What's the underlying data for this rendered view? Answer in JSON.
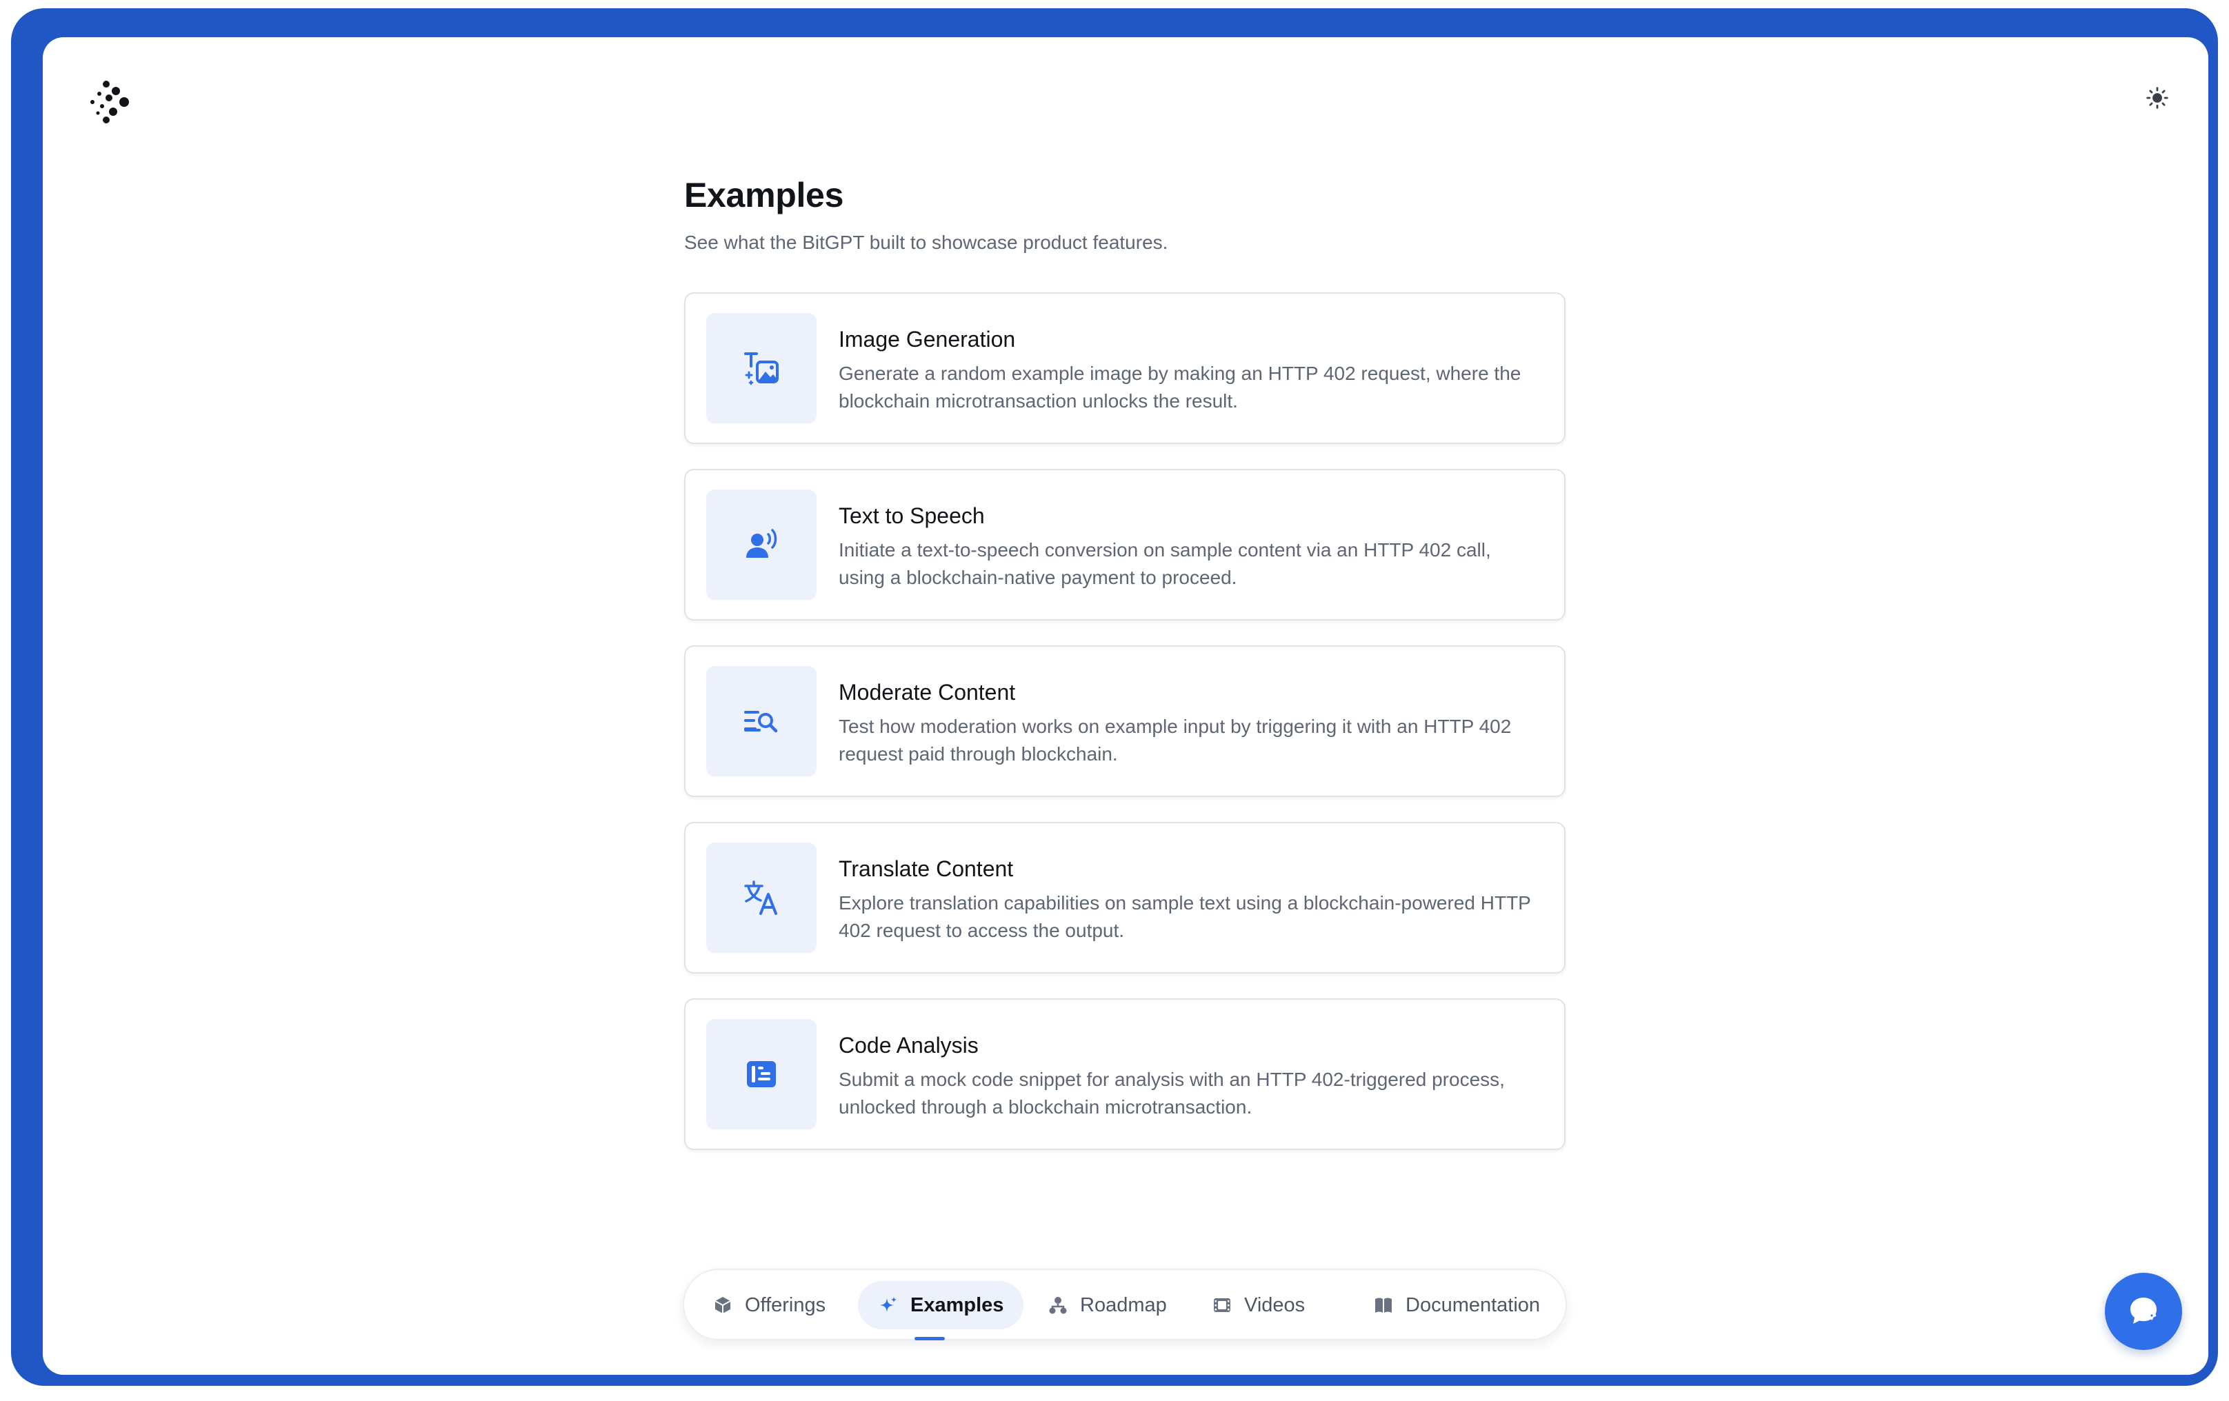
{
  "page": {
    "title": "Examples",
    "subtitle": "See what the BitGPT built to showcase product features."
  },
  "examples": [
    {
      "title": "Image Generation",
      "description": "Generate a random example image by making an HTTP 402 request, where the blockchain microtransaction unlocks the result.",
      "icon": "text-to-image-icon"
    },
    {
      "title": "Text to Speech",
      "description": "Initiate a text-to-speech conversion on sample content via an HTTP 402 call, using a blockchain-native payment to proceed.",
      "icon": "voice-icon"
    },
    {
      "title": "Moderate Content",
      "description": "Test how moderation works on example input by triggering it with an HTTP 402 request paid through blockchain.",
      "icon": "text-search-icon"
    },
    {
      "title": "Translate Content",
      "description": "Explore translation capabilities on sample text using a blockchain-powered HTTP 402 request to access the output.",
      "icon": "translate-icon"
    },
    {
      "title": "Code Analysis",
      "description": "Submit a mock code snippet for analysis with an HTTP 402-triggered process, unlocked through a blockchain microtransaction.",
      "icon": "code-list-icon"
    }
  ],
  "nav": {
    "items": [
      {
        "label": "Offerings",
        "icon": "cube-icon",
        "active": false
      },
      {
        "label": "Examples",
        "icon": "sparkle-icon",
        "active": true
      },
      {
        "label": "Roadmap",
        "icon": "hierarchy-icon",
        "active": false
      },
      {
        "label": "Videos",
        "icon": "film-icon",
        "active": false
      },
      {
        "label": "Documentation",
        "icon": "book-icon",
        "active": false
      }
    ]
  },
  "colors": {
    "frame": "#2157c4",
    "accent": "#2f6fe8",
    "icon_bg": "#edf1fb",
    "title_text": "#111418",
    "muted_text": "#5f6673"
  },
  "icons": {
    "logo": "bitgpt-logo-icon",
    "theme_toggle": "sun-icon",
    "chat_fab": "chat-sparkle-icon"
  }
}
